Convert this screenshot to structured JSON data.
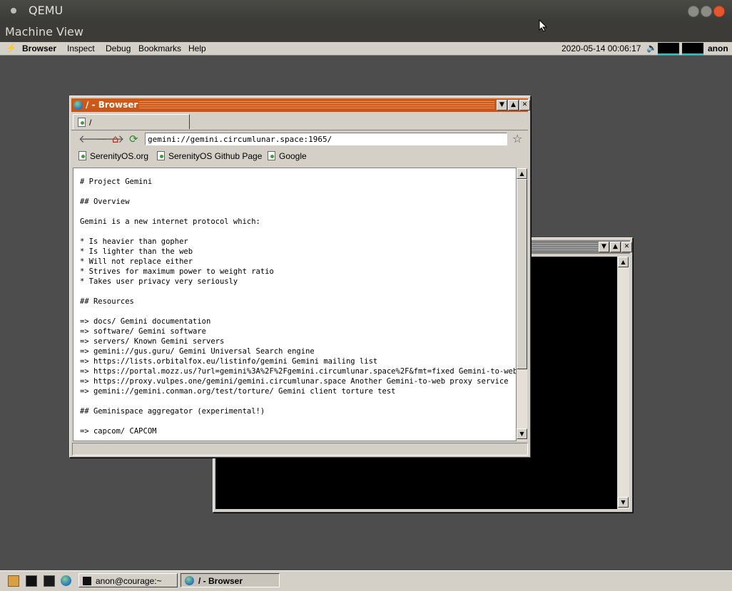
{
  "host": {
    "title": "QEMU",
    "menu": [
      "Machine",
      "View"
    ]
  },
  "topbar": {
    "items": [
      "Browser",
      "Inspect",
      "Debug",
      "Bookmarks",
      "Help"
    ],
    "clock": "2020-05-14 00:06:17",
    "user": "anon"
  },
  "browser": {
    "title": "/ - Browser",
    "tab": "/",
    "url": "gemini://gemini.circumlunar.space:1965/",
    "bookmarks": [
      "SerenityOS.org",
      "SerenityOS Github Page",
      "Google"
    ],
    "content": "# Project Gemini\n\n## Overview\n\nGemini is a new internet protocol which:\n\n* Is heavier than gopher\n* Is lighter than the web\n* Will not replace either\n* Strives for maximum power to weight ratio\n* Takes user privacy very seriously\n\n## Resources\n\n=> docs/ Gemini documentation\n=> software/ Gemini software\n=> servers/ Known Gemini servers\n=> gemini://gus.guru/ Gemini Universal Search engine\n=> https://lists.orbitalfox.eu/listinfo/gemini Gemini mailing list\n=> https://portal.mozz.us/?url=gemini%3A%2F%2Fgemini.circumlunar.space%2F&fmt=fixed Gemini-to-web proxy service\n=> https://proxy.vulpes.one/gemini/gemini.circumlunar.space Another Gemini-to-web proxy service\n=> gemini://gemini.conman.org/test/torture/ Gemini client torture test\n\n## Geminispace aggregator (experimental!)\n\n=> capcom/ CAPCOM"
  },
  "taskbar": {
    "buttons": [
      "anon@courage:~",
      "/ - Browser"
    ]
  },
  "colors": {
    "desktop": "#4d4d4d",
    "active_title": "#d35a14",
    "chrome": "#d4d0c8"
  }
}
